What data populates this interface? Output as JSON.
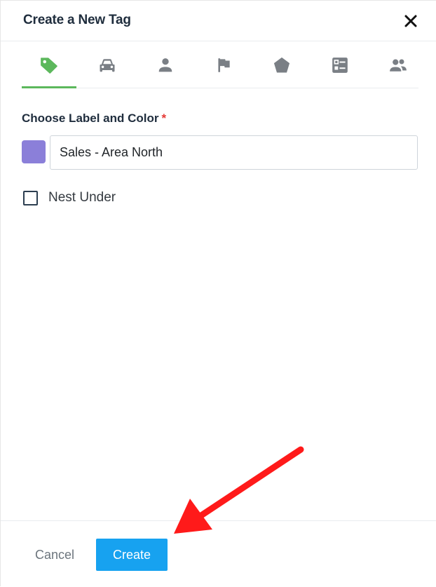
{
  "dialog": {
    "title": "Create a New Tag",
    "close_icon": "close-icon"
  },
  "tabs": [
    {
      "id": "tag",
      "icon": "tag-icon",
      "active": true
    },
    {
      "id": "vehicle",
      "icon": "car-icon",
      "active": false
    },
    {
      "id": "person",
      "icon": "person-icon",
      "active": false
    },
    {
      "id": "flag",
      "icon": "flag-icon",
      "active": false
    },
    {
      "id": "zone",
      "icon": "pentagon-icon",
      "active": false
    },
    {
      "id": "checklist",
      "icon": "checklist-icon",
      "active": false
    },
    {
      "id": "group",
      "icon": "people-icon",
      "active": false
    }
  ],
  "form": {
    "section_label": "Choose Label and Color",
    "required_marker": "*",
    "color": "#8b7fd9",
    "label_value": "Sales - Area North",
    "nest_label": "Nest Under",
    "nest_checked": false
  },
  "footer": {
    "cancel_label": "Cancel",
    "create_label": "Create"
  },
  "colors": {
    "accent": "#17a2f0",
    "active_tab": "#5cb85c",
    "icon_inactive": "#7a7f85",
    "annotation_arrow": "#ff1a1a"
  },
  "annotation": {
    "arrow_icon": "red-arrow-pointing-to-create-button"
  }
}
